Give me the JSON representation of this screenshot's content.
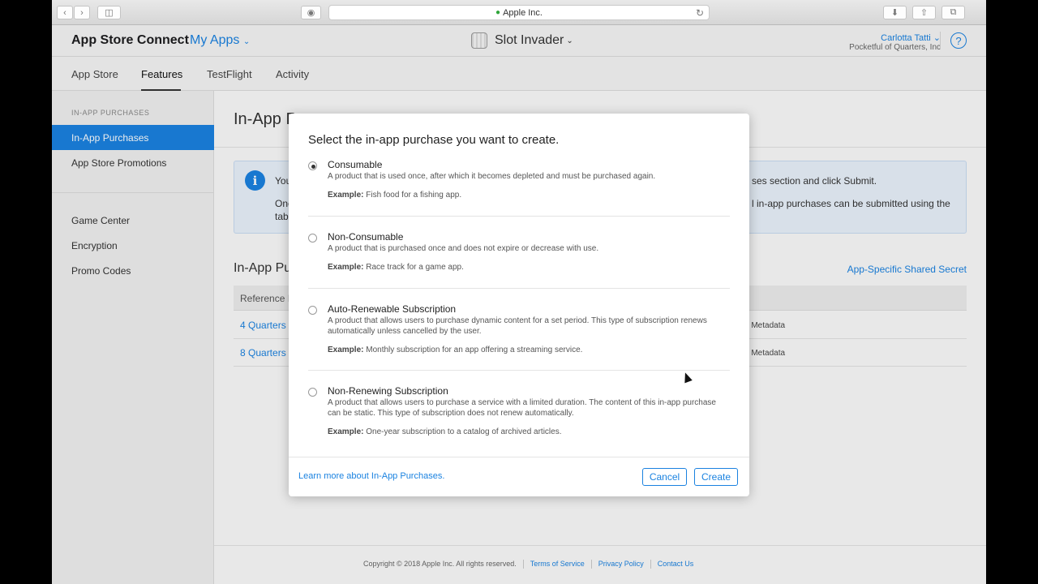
{
  "browser": {
    "url": "Apple Inc.",
    "back_icon": "chevron-left-icon",
    "forward_icon": "chevron-right-icon"
  },
  "header": {
    "brand": "App Store Connect",
    "my_apps": "My Apps",
    "app_name": "Slot Invader",
    "user_name": "Carlotta Tatti",
    "user_org": "Pocketful of Quarters, Inc",
    "help": "?"
  },
  "tabs": [
    "App Store",
    "Features",
    "TestFlight",
    "Activity"
  ],
  "sidebar": {
    "section_label": "IN-APP PURCHASES",
    "items": [
      "In-App Purchases",
      "App Store Promotions",
      "Game Center",
      "Encryption",
      "Promo Codes"
    ]
  },
  "main": {
    "page_title": "In-App Pu",
    "info_line1_left": "You",
    "info_line1_right": "ses section and click Submit.",
    "info_line2_left": "One",
    "info_line2_right": "l in-app purchases can be submitted using the",
    "info_line3_left": "tab",
    "section_title": "In-App Pu",
    "shared_secret": "App-Specific Shared Secret",
    "table_header": "Reference I",
    "rows": [
      {
        "name": "4 Quarters",
        "status": "g Metadata"
      },
      {
        "name": "8 Quarters",
        "status": "g Metadata"
      }
    ]
  },
  "modal": {
    "title": "Select the in-app purchase you want to create.",
    "example_label": "Example:",
    "options": [
      {
        "name": "Consumable",
        "desc": "A product that is used once, after which it becomes depleted and must be purchased again.",
        "example": "Fish food for a fishing app.",
        "selected": true
      },
      {
        "name": "Non-Consumable",
        "desc": "A product that is purchased once and does not expire or decrease with use.",
        "example": "Race track for a game app.",
        "selected": false
      },
      {
        "name": "Auto-Renewable Subscription",
        "desc": "A product that allows users to purchase dynamic content for a set period. This type of subscription renews automatically unless cancelled by the user.",
        "example": "Monthly subscription for an app offering a streaming service.",
        "selected": false
      },
      {
        "name": "Non-Renewing Subscription",
        "desc": "A product that allows users to purchase a service with a limited duration. The content of this in-app purchase can be static. This type of subscription does not renew automatically.",
        "example": "One-year subscription to a catalog of archived articles.",
        "selected": false
      }
    ],
    "learn_more": "Learn more about In-App Purchases.",
    "cancel": "Cancel",
    "create": "Create"
  },
  "footer": {
    "copyright": "Copyright © 2018 Apple Inc. All rights reserved.",
    "terms": "Terms of Service",
    "privacy": "Privacy Policy",
    "contact": "Contact Us"
  },
  "colors": {
    "accent": "#1a82e0",
    "selected_sidebar": "#1a82e0"
  }
}
